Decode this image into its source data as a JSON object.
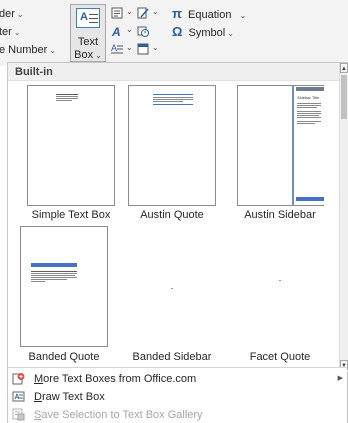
{
  "ribbon": {
    "items_left": [
      {
        "label": "der"
      },
      {
        "label": "ter"
      },
      {
        "label": "e Number"
      }
    ],
    "textbox_button": {
      "line1": "Text",
      "line2": "Box"
    },
    "symbols": {
      "equation_glyph": "π",
      "equation_label": "Equation",
      "symbol_glyph": "Ω",
      "symbol_label": "Symbol"
    }
  },
  "gallery": {
    "section_title": "Built-in",
    "tiles": [
      {
        "caption": "Simple Text Box"
      },
      {
        "caption": "Austin Quote"
      },
      {
        "caption": "Austin Sidebar"
      },
      {
        "caption": "Banded Quote"
      },
      {
        "caption": "Banded Sidebar"
      },
      {
        "caption": "Facet Quote"
      }
    ],
    "austin_sidebar_title": "Sidebar Title"
  },
  "menu": {
    "items": [
      {
        "label_u": "M",
        "label_rest": "ore Text Boxes from Office.com",
        "enabled": true
      },
      {
        "label_u": "D",
        "label_rest": "raw Text Box",
        "enabled": true
      },
      {
        "label_u": "S",
        "label_rest": "ave Selection to Text Box Gallery",
        "enabled": false
      }
    ]
  },
  "colors": {
    "accent": "#2d5d9b",
    "tile_blue": "#4472c4",
    "panel_border": "#c6c6c6"
  },
  "icons": [
    "chevron-down-icon",
    "textbox-icon",
    "quick-parts-icon",
    "wordart-icon",
    "dropcap-icon",
    "signature-line-icon",
    "date-time-icon",
    "object-icon",
    "equation-icon",
    "symbol-icon",
    "office-com-icon",
    "draw-textbox-icon",
    "save-selection-icon",
    "chevron-right-icon",
    "scroll-up-icon",
    "scroll-down-icon"
  ]
}
